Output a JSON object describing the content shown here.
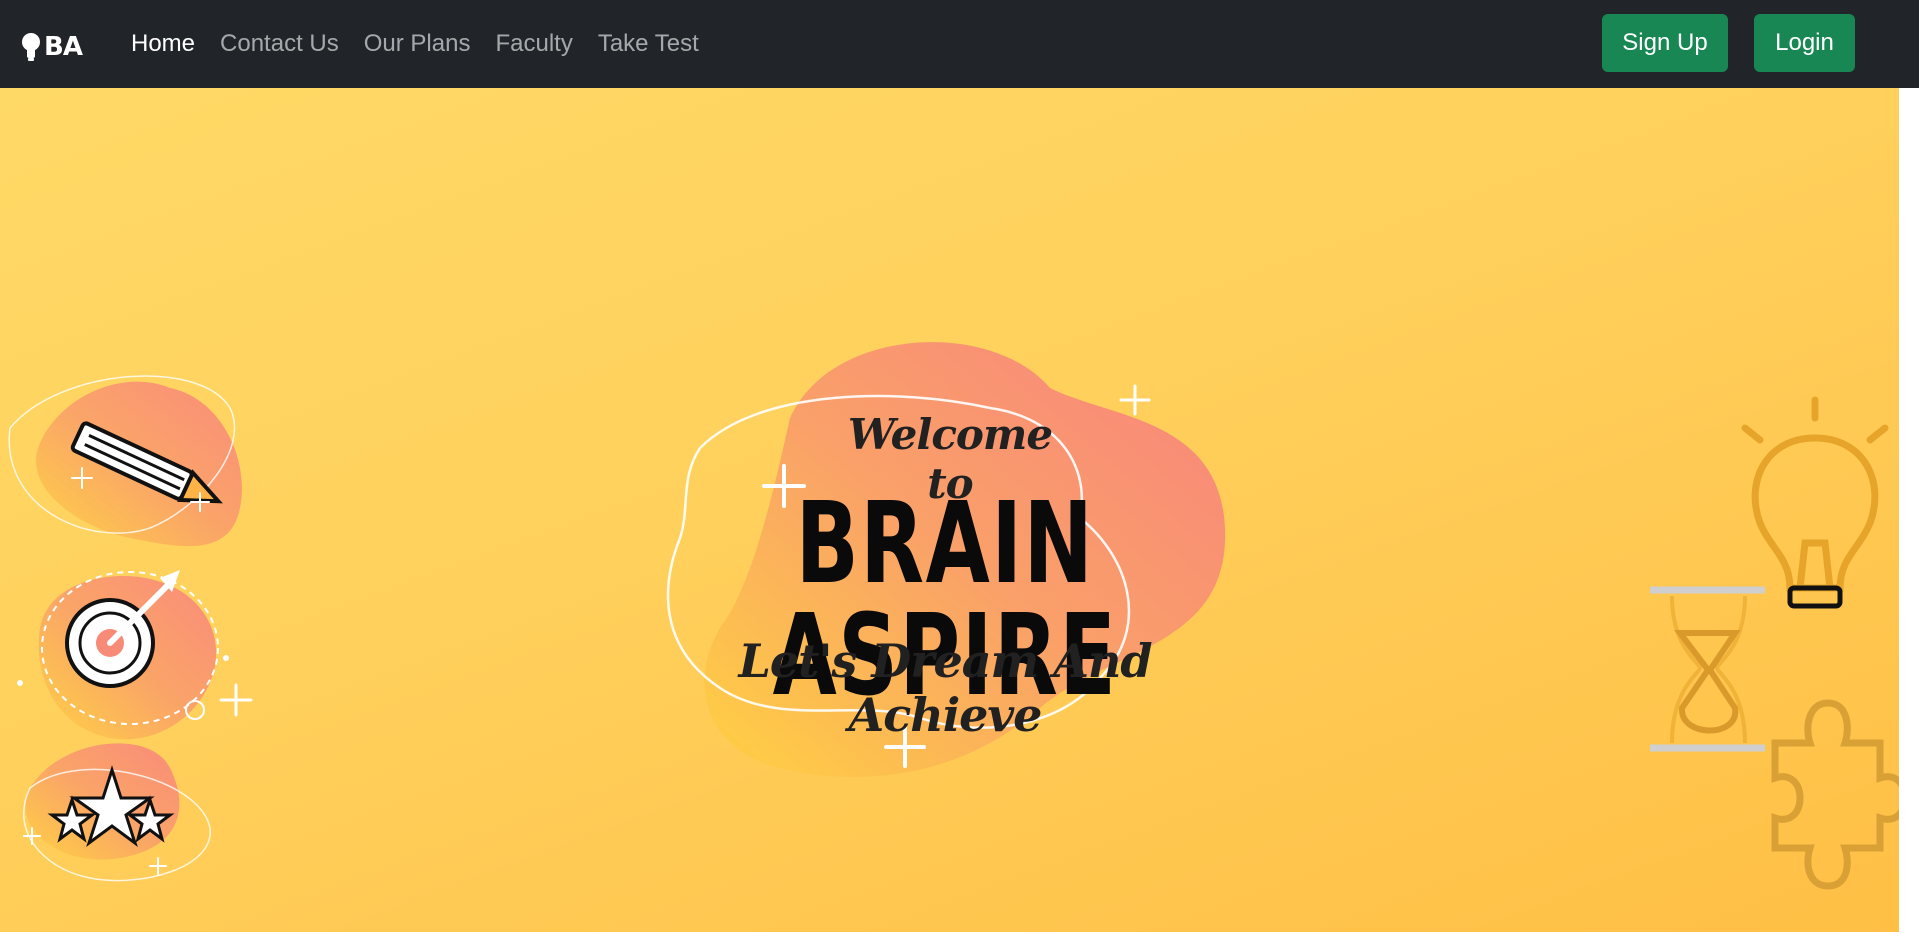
{
  "navbar": {
    "brand_text": "BA",
    "links": [
      {
        "label": "Home",
        "active": true
      },
      {
        "label": "Contact Us",
        "active": false
      },
      {
        "label": "Our Plans",
        "active": false
      },
      {
        "label": "Faculty",
        "active": false
      },
      {
        "label": "Take Test",
        "active": false
      }
    ],
    "signup_label": "Sign Up",
    "login_label": "Login"
  },
  "hero": {
    "welcome": "Welcome to",
    "title": "BRAIN ASPIRE",
    "tagline": "Let's Dream And Achieve",
    "left_icons": [
      "pencil-icon",
      "target-icon",
      "stars-icon"
    ],
    "right_icons": [
      "lightbulb-icon",
      "hourglass-icon",
      "puzzle-icon"
    ]
  },
  "colors": {
    "navbar_bg": "#212529",
    "button_bg": "#198754",
    "hero_bg": "#ffd05c",
    "blob": "#f88a78"
  }
}
